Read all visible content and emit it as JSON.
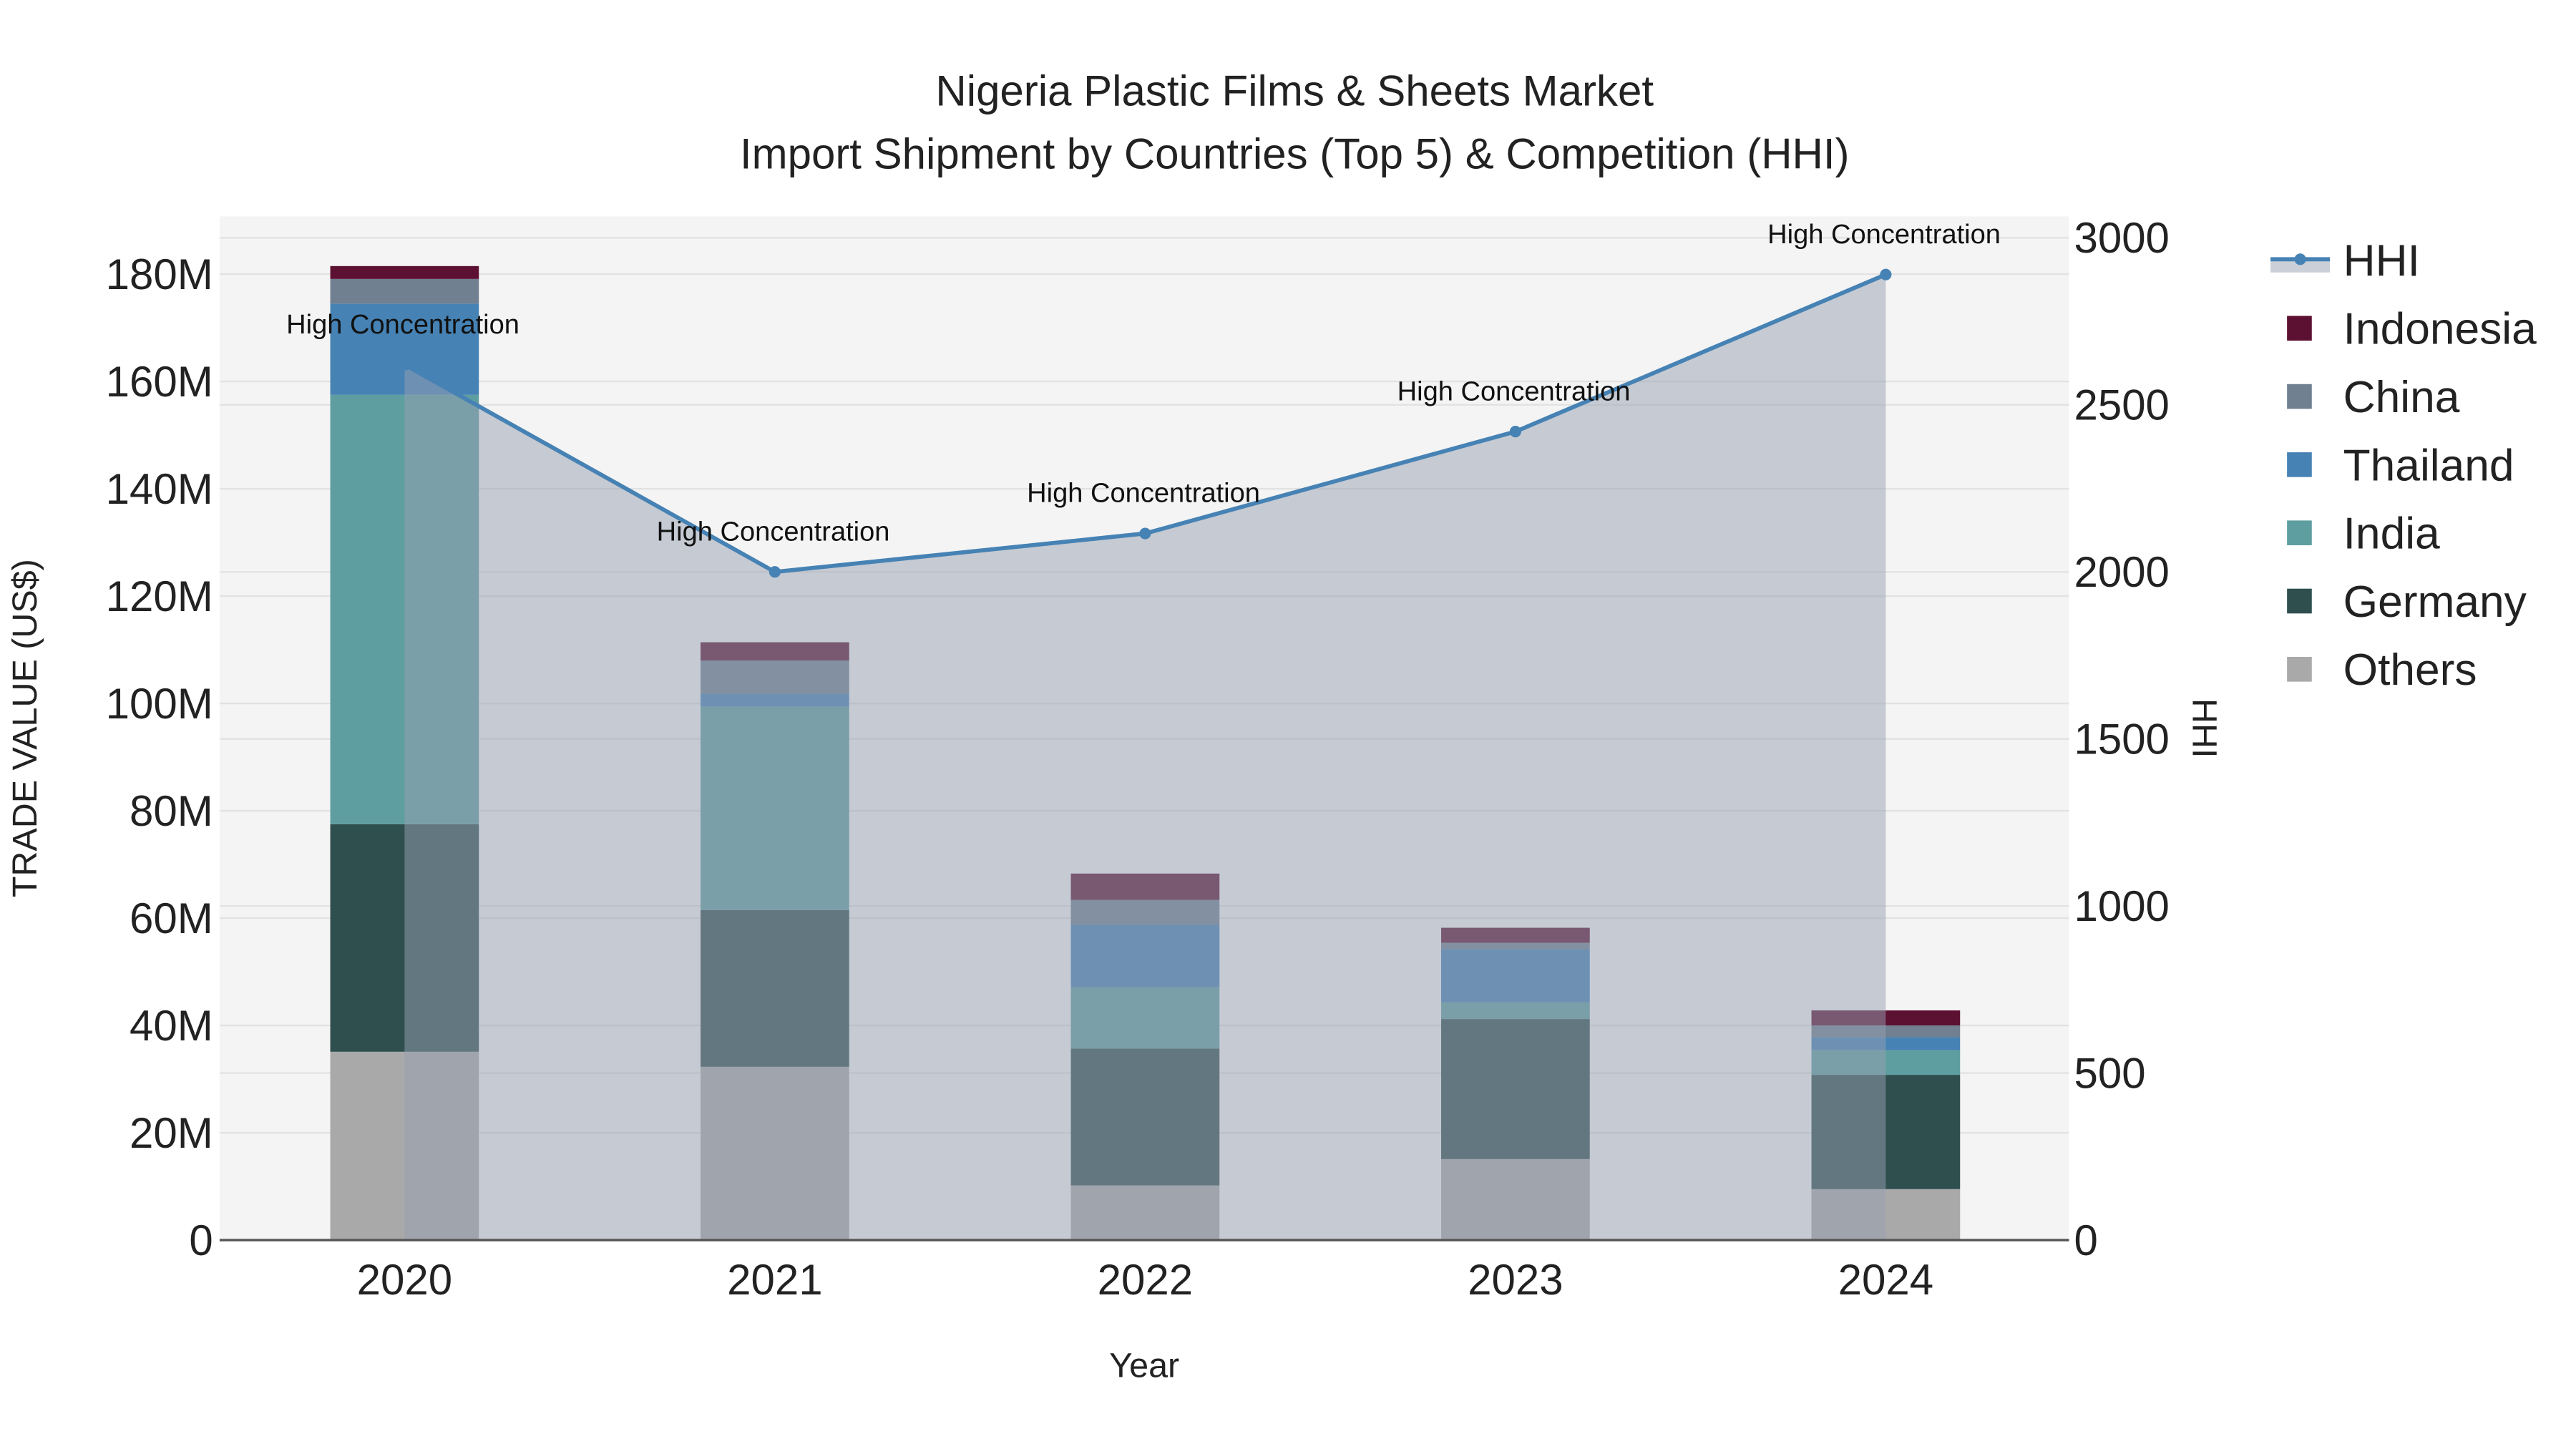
{
  "chart_data": {
    "type": "bar",
    "title": "Nigeria Plastic Films & Sheets Market",
    "subtitle": "Import Shipment by Countries (Top 5) & Competition (HHI)",
    "xlabel": "Year",
    "ylabel": "TRADE VALUE (US$)",
    "y2label": "HHI",
    "categories": [
      "2020",
      "2021",
      "2022",
      "2023",
      "2024"
    ],
    "ylim": [
      0,
      190000000
    ],
    "y2lim": [
      0,
      3000
    ],
    "yticks": [
      0,
      20000000,
      40000000,
      60000000,
      80000000,
      100000000,
      120000000,
      140000000,
      160000000,
      180000000
    ],
    "ytick_labels": [
      "0",
      "20M",
      "40M",
      "60M",
      "80M",
      "100M",
      "120M",
      "140M",
      "160M",
      "180M"
    ],
    "y2ticks": [
      0,
      500,
      1000,
      1500,
      2000,
      2500,
      3000
    ],
    "y2tick_labels": [
      "0",
      "500",
      "1000",
      "1500",
      "2000",
      "2500",
      "3000"
    ],
    "grid": true,
    "legend_position": "right",
    "series": [
      {
        "name": "Others",
        "color": "#a9a9a9",
        "values": [
          35100000,
          32300000,
          10200000,
          15100000,
          9500000
        ]
      },
      {
        "name": "Germany",
        "color": "#2f4f4f",
        "values": [
          42400000,
          29200000,
          25500000,
          26100000,
          21300000
        ]
      },
      {
        "name": "India",
        "color": "#5f9ea0",
        "values": [
          80000000,
          37900000,
          11400000,
          3100000,
          4600000
        ]
      },
      {
        "name": "Thailand",
        "color": "#4682b4",
        "values": [
          17000000,
          2400000,
          11700000,
          9900000,
          2400000
        ]
      },
      {
        "name": "China",
        "color": "#708090",
        "values": [
          4600000,
          6200000,
          4600000,
          1200000,
          2200000
        ]
      },
      {
        "name": "Indonesia",
        "color": "#5c1032",
        "values": [
          2400000,
          3400000,
          4900000,
          2800000,
          2800000
        ]
      }
    ],
    "hhi": {
      "name": "HHI",
      "color": "#4682b4",
      "values": [
        2620,
        2000,
        2115,
        2420,
        2890
      ],
      "annotations": [
        "High Concentration",
        "High Concentration",
        "High Concentration",
        "High Concentration",
        "High Concentration"
      ]
    },
    "legend_order": [
      "HHI",
      "Indonesia",
      "China",
      "Thailand",
      "India",
      "Germany",
      "Others"
    ]
  }
}
